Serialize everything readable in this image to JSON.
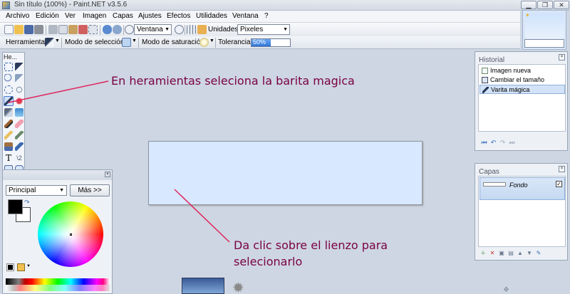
{
  "window": {
    "title": "Sin título (100%) - Paint.NET v3.5.6",
    "minimize_label": "▁",
    "restore_label": "❐",
    "close_label": "✕"
  },
  "menu": {
    "items": [
      "Archivo",
      "Edición",
      "Ver",
      "Imagen",
      "Capas",
      "Ajustes",
      "Efectos",
      "Utilidades",
      "Ventana",
      "?"
    ]
  },
  "toolbar": {
    "zoom_combo": "Ventana",
    "units_label": "Unidades:",
    "units_value": "Pixeles"
  },
  "tool_options": {
    "tool_label": "Herramienta:",
    "selection_mode_label": "Modo de selección:",
    "fill_mode_label": "Modo de saturación",
    "tolerance_label": "Tolerancia:",
    "tolerance_value": "50%",
    "tolerance_fraction": 0.5
  },
  "tools_window": {
    "title": "He..."
  },
  "colors_window": {
    "palette_select": "Principal",
    "more_button": "Más >>"
  },
  "history": {
    "title": "Historial",
    "items": [
      "Imagen nueva",
      "Cambiar el tamaño",
      "Varita mágica"
    ],
    "selected_index": 2
  },
  "layers": {
    "title": "Capas",
    "items": [
      {
        "name": "Fondo",
        "visible": true
      }
    ]
  },
  "annotations": {
    "top": "En heramientas seleciona la barita magica",
    "bottom_line1": "Da clic sobre el lienzo para",
    "bottom_line2": "selecionarlo"
  },
  "colors": {
    "annotation": "#7a0044",
    "arrow": "#e0245e",
    "canvas": "#d8e8ff",
    "desktop": "#cdd6e2"
  }
}
